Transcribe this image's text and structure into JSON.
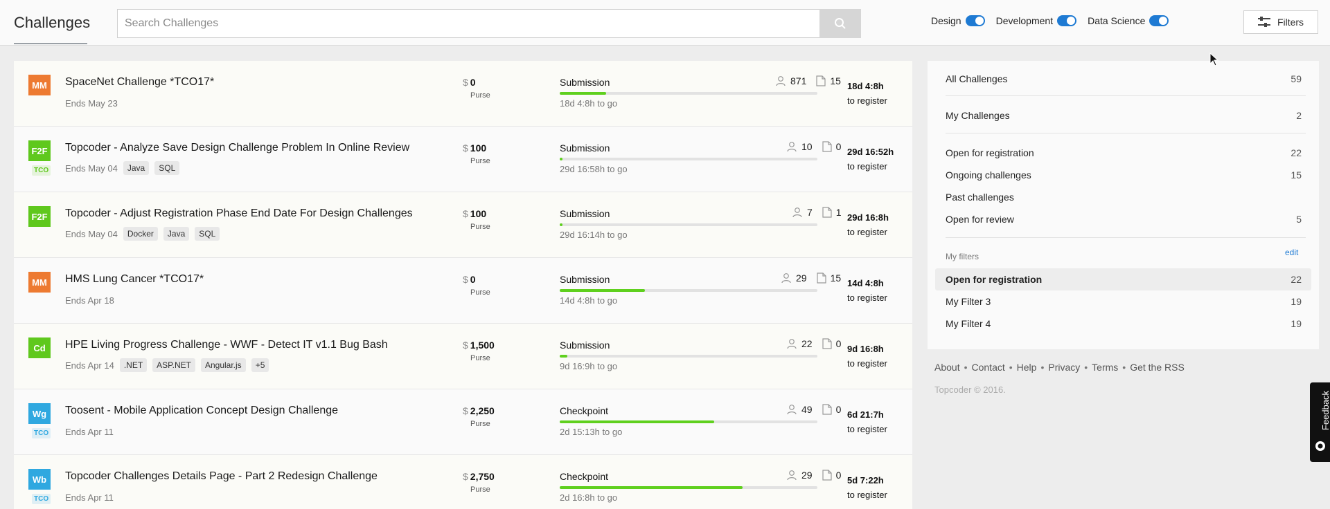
{
  "header": {
    "title": "Challenges",
    "search_placeholder": "Search Challenges",
    "toggles": [
      {
        "label": "Design",
        "on": true
      },
      {
        "label": "Development",
        "on": true
      },
      {
        "label": "Data Science",
        "on": true
      }
    ],
    "filters_label": "Filters"
  },
  "challenges": [
    {
      "badge": "MM",
      "badge_color": "#ed7a31",
      "tco": "",
      "title": "SpaceNet Challenge *TCO17*",
      "ends": "Ends May 23",
      "tags": [],
      "currency": "$",
      "purse": "0",
      "purse_label": "Purse",
      "phase": "Submission",
      "progress": 0.18,
      "phase_time": "18d 4:8h to go",
      "registrants": "871",
      "submissions": "15",
      "reg_time": "18d 4:8h",
      "reg_label": "to register"
    },
    {
      "badge": "F2F",
      "badge_color": "#5fc81d",
      "tco": "TCO",
      "tco_color": "#5fc81d",
      "title": "Topcoder - Analyze Save Design Challenge Problem In Online Review",
      "ends": "Ends May 04",
      "tags": [
        "Java",
        "SQL"
      ],
      "currency": "$",
      "purse": "100",
      "purse_label": "Purse",
      "phase": "Submission",
      "progress": 0.01,
      "phase_time": "29d 16:58h to go",
      "registrants": "10",
      "submissions": "0",
      "reg_time": "29d 16:52h",
      "reg_label": "to register"
    },
    {
      "badge": "F2F",
      "badge_color": "#5fc81d",
      "tco": "",
      "title": "Topcoder - Adjust Registration Phase End Date For Design Challenges",
      "ends": "Ends May 04",
      "tags": [
        "Docker",
        "Java",
        "SQL"
      ],
      "currency": "$",
      "purse": "100",
      "purse_label": "Purse",
      "phase": "Submission",
      "progress": 0.01,
      "phase_time": "29d 16:14h to go",
      "registrants": "7",
      "submissions": "1",
      "reg_time": "29d 16:8h",
      "reg_label": "to register"
    },
    {
      "badge": "MM",
      "badge_color": "#ed7a31",
      "tco": "",
      "title": "HMS Lung Cancer *TCO17*",
      "ends": "Ends Apr 18",
      "tags": [],
      "currency": "$",
      "purse": "0",
      "purse_label": "Purse",
      "phase": "Submission",
      "progress": 0.33,
      "phase_time": "14d 4:8h to go",
      "registrants": "29",
      "submissions": "15",
      "reg_time": "14d 4:8h",
      "reg_label": "to register"
    },
    {
      "badge": "Cd",
      "badge_color": "#5fc81d",
      "tco": "",
      "title": "HPE Living Progress Challenge - WWF - Detect IT v1.1 Bug Bash",
      "ends": "Ends Apr 14",
      "tags": [
        ".NET",
        "ASP.NET",
        "Angular.js",
        "+5"
      ],
      "currency": "$",
      "purse": "1,500",
      "purse_label": "Purse",
      "phase": "Submission",
      "progress": 0.03,
      "phase_time": "9d 16:9h to go",
      "registrants": "22",
      "submissions": "0",
      "reg_time": "9d 16:8h",
      "reg_label": "to register"
    },
    {
      "badge": "Wg",
      "badge_color": "#2fa8e0",
      "tco": "TCO",
      "tco_color": "#2fa8e0",
      "title": "Toosent - Mobile Application Concept Design Challenge",
      "ends": "Ends Apr 11",
      "tags": [],
      "currency": "$",
      "purse": "2,250",
      "purse_label": "Purse",
      "phase": "Checkpoint",
      "progress": 0.6,
      "phase_time": "2d 15:13h to go",
      "registrants": "49",
      "submissions": "0",
      "reg_time": "6d 21:7h",
      "reg_label": "to register"
    },
    {
      "badge": "Wb",
      "badge_color": "#2fa8e0",
      "tco": "TCO",
      "tco_color": "#2fa8e0",
      "title": "Topcoder Challenges Details Page - Part 2 Redesign Challenge",
      "ends": "Ends Apr 11",
      "tags": [],
      "currency": "$",
      "purse": "2,750",
      "purse_label": "Purse",
      "phase": "Checkpoint",
      "progress": 0.71,
      "phase_time": "2d 16:8h to go",
      "registrants": "29",
      "submissions": "0",
      "reg_time": "5d 7:22h",
      "reg_label": "to register"
    }
  ],
  "sidebar": {
    "all": {
      "label": "All Challenges",
      "count": "59"
    },
    "mine": {
      "label": "My Challenges",
      "count": "2"
    },
    "groups": [
      {
        "label": "Open for registration",
        "count": "22"
      },
      {
        "label": "Ongoing challenges",
        "count": "15"
      },
      {
        "label": "Past challenges",
        "count": ""
      },
      {
        "label": "Open for review",
        "count": "5"
      }
    ],
    "my_filters_label": "My filters",
    "edit_label": "edit",
    "my_filters": [
      {
        "label": "Open for registration",
        "count": "22",
        "active": true
      },
      {
        "label": "My Filter 3",
        "count": "19",
        "active": false
      },
      {
        "label": "My Filter 4",
        "count": "19",
        "active": false
      }
    ]
  },
  "footer": {
    "links": [
      "About",
      "Contact",
      "Help",
      "Privacy",
      "Terms",
      "Get the RSS"
    ],
    "separator": "•",
    "copyright": "Topcoder © 2016."
  },
  "feedback_label": "Feedback",
  "colors": {
    "accent": "#1e7ad3",
    "progress": "#5fd01e"
  }
}
